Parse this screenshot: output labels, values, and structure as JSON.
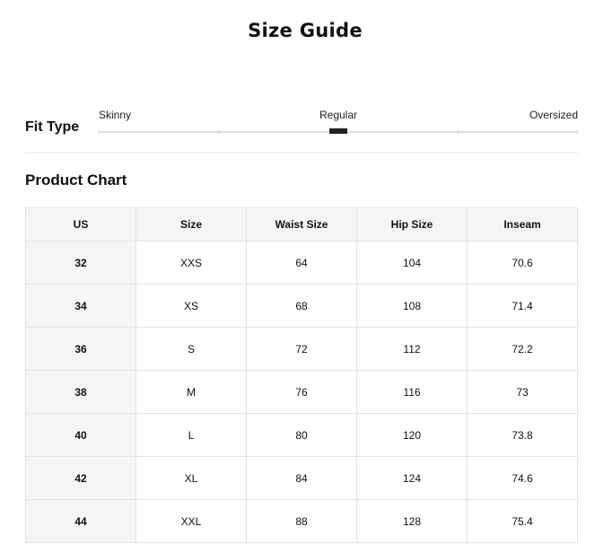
{
  "page": {
    "title": "Size Guide"
  },
  "fit_type": {
    "label": "Fit Type",
    "options": [
      "Skinny",
      "Regular",
      "Oversized"
    ],
    "selected": "Regular",
    "selected_position": 0.5
  },
  "product_chart": {
    "title": "Product Chart",
    "columns": [
      "US",
      "Size",
      "Waist Size",
      "Hip Size",
      "Inseam"
    ],
    "rows": [
      [
        "32",
        "XXS",
        "64",
        "104",
        "70.6"
      ],
      [
        "34",
        "XS",
        "68",
        "108",
        "71.4"
      ],
      [
        "36",
        "S",
        "72",
        "112",
        "72.2"
      ],
      [
        "38",
        "M",
        "76",
        "116",
        "73"
      ],
      [
        "40",
        "L",
        "80",
        "120",
        "73.8"
      ],
      [
        "42",
        "XL",
        "84",
        "124",
        "74.6"
      ],
      [
        "44",
        "XXL",
        "88",
        "128",
        "75.4"
      ]
    ]
  },
  "colors": {
    "marker": "#222222",
    "header_bg": "#f5f5f5",
    "border": "#e3e3e3"
  }
}
